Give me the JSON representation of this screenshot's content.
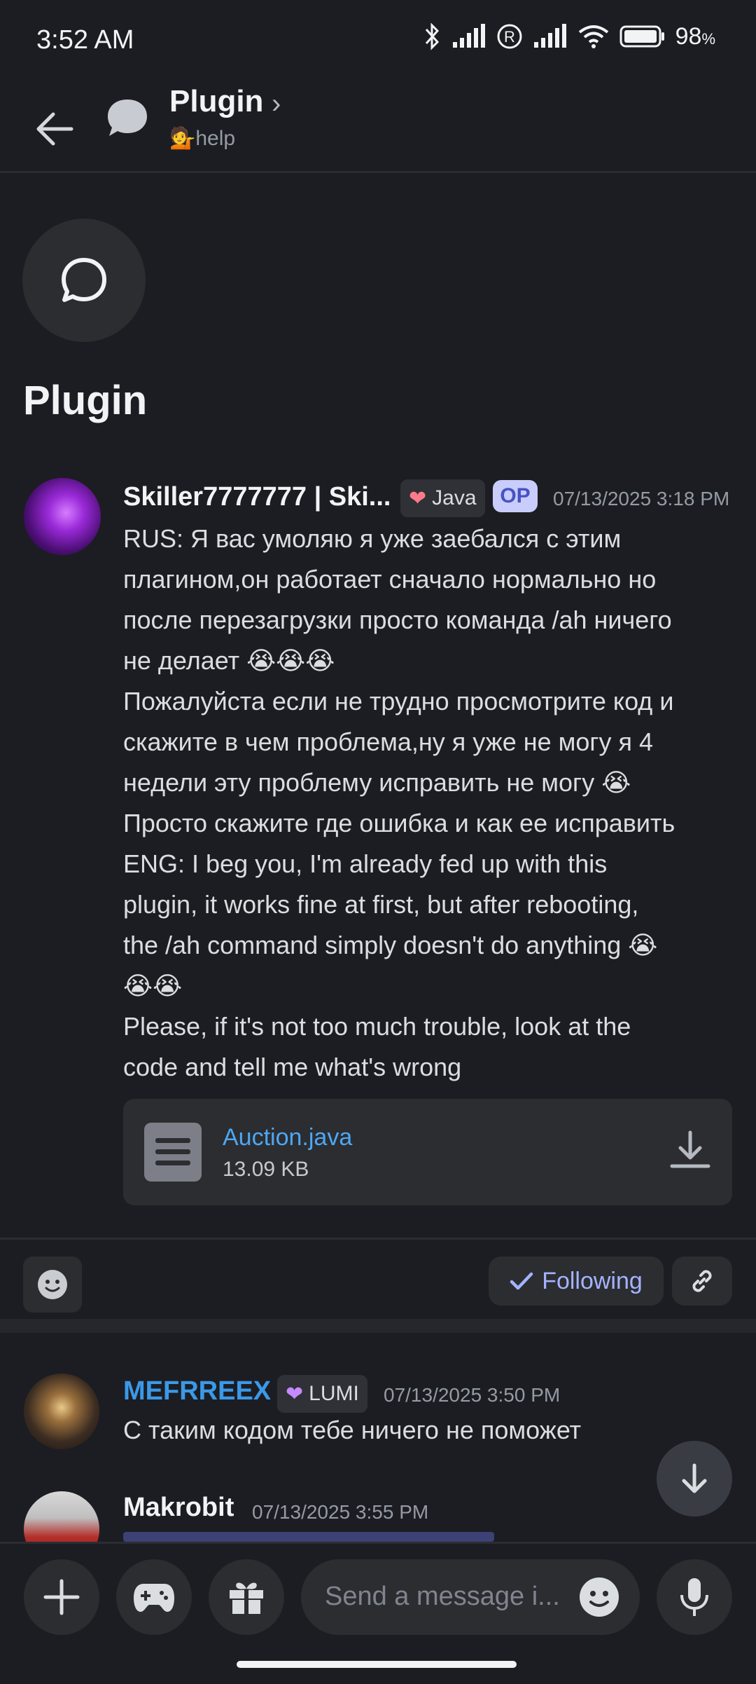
{
  "status_bar": {
    "time": "3:52 AM",
    "battery": "98"
  },
  "header": {
    "title": "Plugin",
    "channel": "💁help"
  },
  "thread": {
    "title": "Plugin"
  },
  "op_message": {
    "author": "Skiller7777777 | Ski...",
    "tag_label": "Java",
    "op_badge": "OP",
    "timestamp": "07/13/2025 3:18 PM",
    "lines": [
      "RUS: Я вас умоляю я уже заебался с этим",
      "плагином,он работает сначало нормально но",
      "после перезагрузки просто команда /ah ничего",
      "не делает 😭😭😭",
      "Пожалуйста если не трудно просмотрите код и",
      "скажите в чем проблема,ну я уже не могу я 4",
      "недели эту проблему исправить не могу 😭",
      "Просто скажите где ошибка и как ее исправить",
      "ENG: I beg you, I'm already fed up with this",
      "plugin, it works fine at first, but after rebooting,",
      "the /ah command simply doesn't do anything 😭",
      "😭😭",
      "Please, if it's not too much trouble, look at the",
      "code and tell me what's wrong"
    ],
    "attachment": {
      "name": "Auction.java",
      "size": "13.09 KB"
    }
  },
  "actions": {
    "following_label": "Following"
  },
  "replies": [
    {
      "author": "MEFRREEX",
      "tag_label": "LUMI",
      "timestamp": "07/13/2025 3:50 PM",
      "text": "С таким кодом тебе ничего не поможет"
    },
    {
      "author": "Makrobit",
      "timestamp": "07/13/2025 3:55 PM"
    }
  ],
  "composer": {
    "placeholder": "Send a message i..."
  },
  "colors": {
    "background": "#1c1d22",
    "link": "#4ea7f2",
    "accent": "#a5b3ff",
    "op_badge": "#c9cdfb"
  }
}
